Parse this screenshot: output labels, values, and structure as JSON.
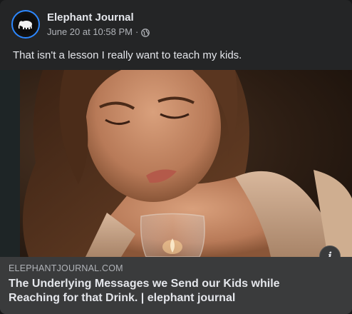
{
  "post": {
    "page_name": "Elephant Journal",
    "timestamp": "June 20 at 10:58 PM",
    "separator": "·",
    "audience_icon": "globe-icon",
    "text": "That isn't a lesson I really want to teach my kids."
  },
  "link": {
    "domain": "ELEPHANTJOURNAL.COM",
    "title": "The Underlying Messages we Send our Kids while Reaching for that Drink. | elephant journal",
    "info_label": "i"
  },
  "colors": {
    "card_bg": "#242526",
    "preview_bg": "#3a3b3c",
    "primary_text": "#e4e6eb",
    "secondary_text": "#b0b3b8",
    "avatar_ring": "#2d88ff"
  }
}
